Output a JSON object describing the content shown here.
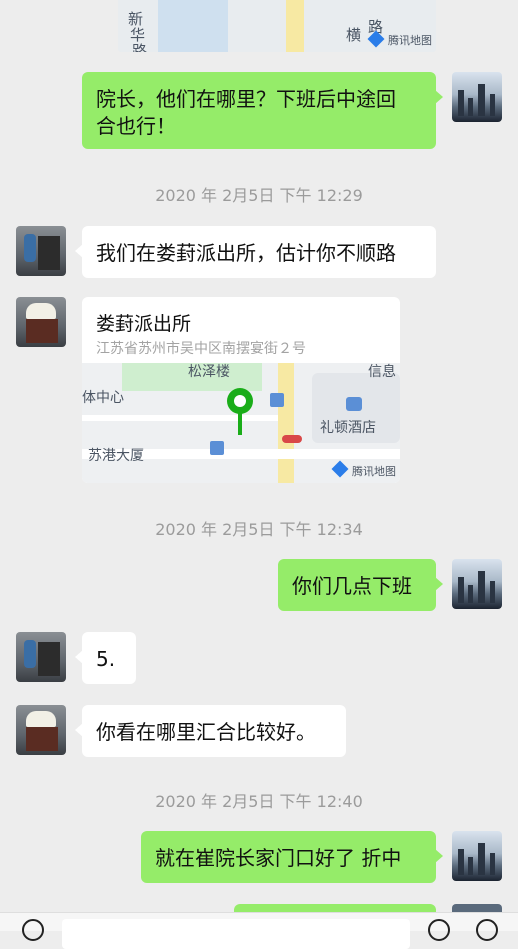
{
  "top_map": {
    "labels": [
      "新",
      "华",
      "路",
      "横",
      "路"
    ],
    "watermark": "腾讯地图"
  },
  "messages": [
    {
      "side": "right",
      "text": "院长，他们在哪里？下班后中途回合也行！"
    },
    {
      "side": "left",
      "text": "我们在娄葑派出所，估计你不顺路"
    },
    {
      "side": "left",
      "text": "5."
    },
    {
      "side": "left",
      "text": "你看在哪里汇合比较好。"
    },
    {
      "side": "right",
      "text": "你们几点下班"
    },
    {
      "side": "right",
      "text": "就在崔院长家门口好了 折中"
    }
  ],
  "message_lines": {
    "first_line1": "院长，他们在哪里？下班后中途回",
    "first_line2": "合也行！"
  },
  "timestamps": [
    "2020 年 2月5日 下午 12:29",
    "2020 年 2月5日 下午 12:34",
    "2020 年 2月5日 下午 12:40"
  ],
  "location": {
    "title": "娄葑派出所",
    "address": "江苏省苏州市吴中区南摆宴街２号",
    "map_labels": [
      "松泽楼",
      "信息",
      "体中心",
      "礼顿酒店",
      "苏港大厦"
    ],
    "watermark": "腾讯地图",
    "pin_color": "#1aad19"
  },
  "colors": {
    "self_bubble": "#95ec69",
    "other_bubble": "#ffffff",
    "background": "#ededed"
  }
}
